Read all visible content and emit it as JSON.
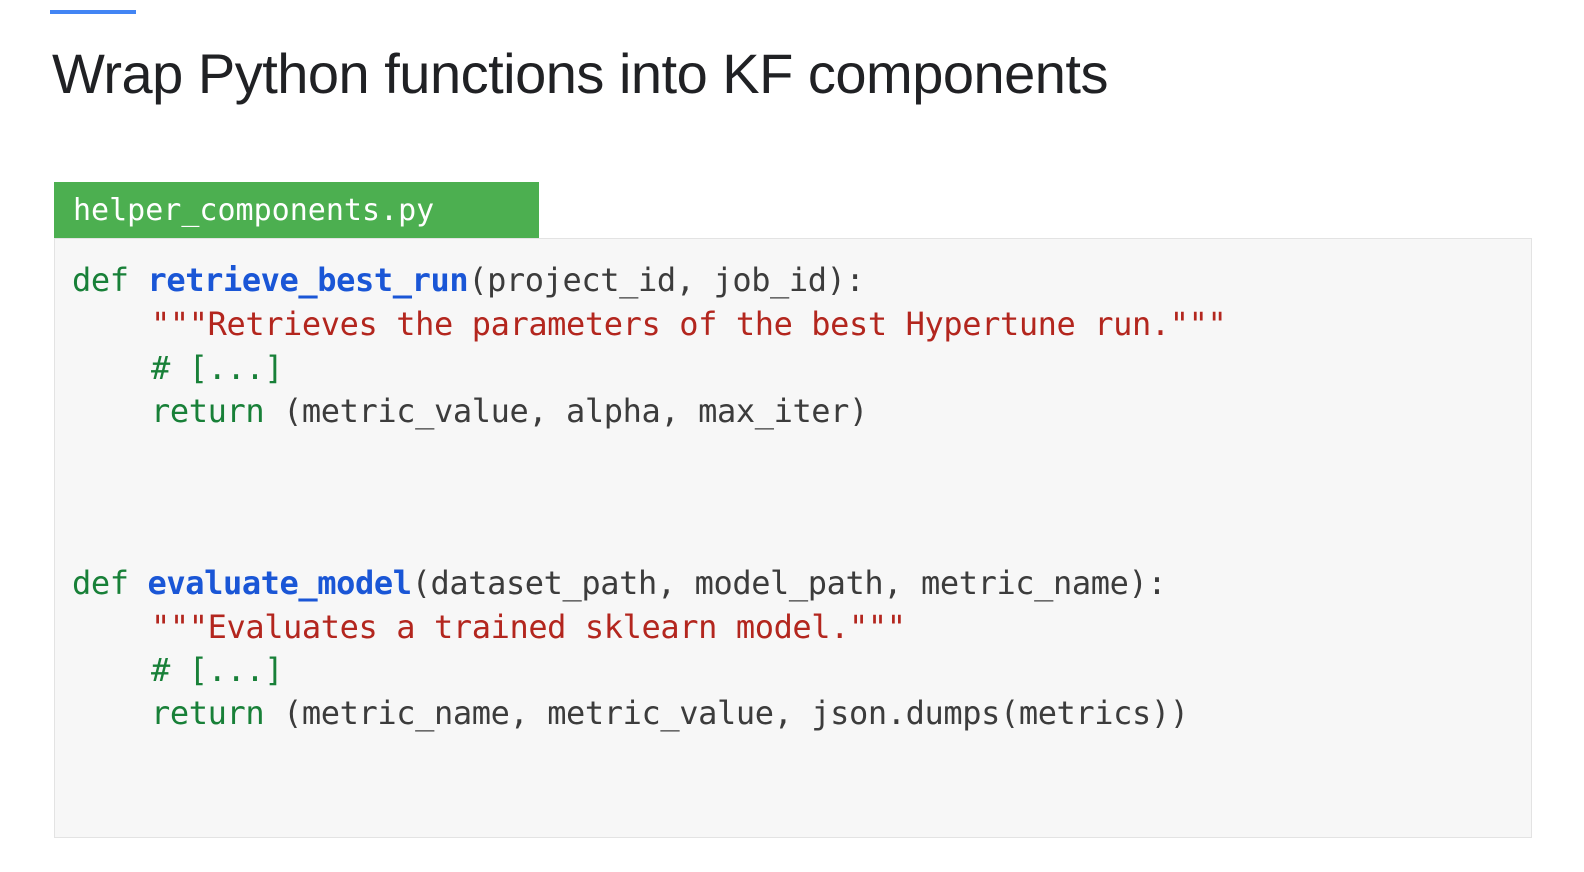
{
  "slide": {
    "title": "Wrap Python functions into KF components",
    "accent_color": "#4285f4"
  },
  "file": {
    "name": "helper_components.py",
    "tab_color": "#4caf50"
  },
  "code": {
    "functions": [
      {
        "def_keyword": "def",
        "name": "retrieve_best_run",
        "signature": "(project_id, job_id):",
        "docstring": "\"\"\"Retrieves the parameters of the best Hypertune run.\"\"\"",
        "comment": "# [...]",
        "return_keyword": "return",
        "return_value": " (metric_value, alpha, max_iter)"
      },
      {
        "def_keyword": "def",
        "name": "evaluate_model",
        "signature": "(dataset_path, model_path, metric_name):",
        "docstring": "\"\"\"Evaluates a trained sklearn model.\"\"\"",
        "comment": "# [...]",
        "return_keyword": "return",
        "return_value": " (metric_name, metric_value, json.dumps(metrics))"
      }
    ],
    "colors": {
      "keyword": "#188038",
      "function_name": "#1a56d6",
      "string": "#b3261e",
      "text": "#3c3c3c"
    }
  }
}
